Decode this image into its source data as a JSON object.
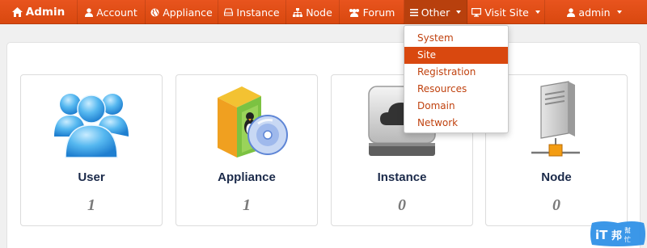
{
  "navbar": {
    "brand": "Admin",
    "items": [
      {
        "label": "Account",
        "icon": "user-icon"
      },
      {
        "label": "Appliance",
        "icon": "globe-icon"
      },
      {
        "label": "Instance",
        "icon": "hdd-icon"
      },
      {
        "label": "Node",
        "icon": "sitemap-icon"
      },
      {
        "label": "Forum",
        "icon": "group-icon"
      },
      {
        "label": "Other",
        "icon": "list-icon"
      },
      {
        "label": "Visit Site",
        "icon": "desktop-icon"
      }
    ],
    "user": "admin",
    "colors": {
      "bar": "#d9480f",
      "active": "#b8400d"
    }
  },
  "dropdown": {
    "items": [
      "System",
      "Site",
      "Registration",
      "Resources",
      "Domain",
      "Network"
    ],
    "selected": "Site"
  },
  "cards": [
    {
      "title": "User",
      "count": "1",
      "icon": "users-icon"
    },
    {
      "title": "Appliance",
      "count": "1",
      "icon": "software-box-icon"
    },
    {
      "title": "Instance",
      "count": "0",
      "icon": "cloud-drive-icon"
    },
    {
      "title": "Node",
      "count": "0",
      "icon": "server-network-icon"
    }
  ],
  "watermark": {
    "logo_text": "iT邦幫忙"
  }
}
